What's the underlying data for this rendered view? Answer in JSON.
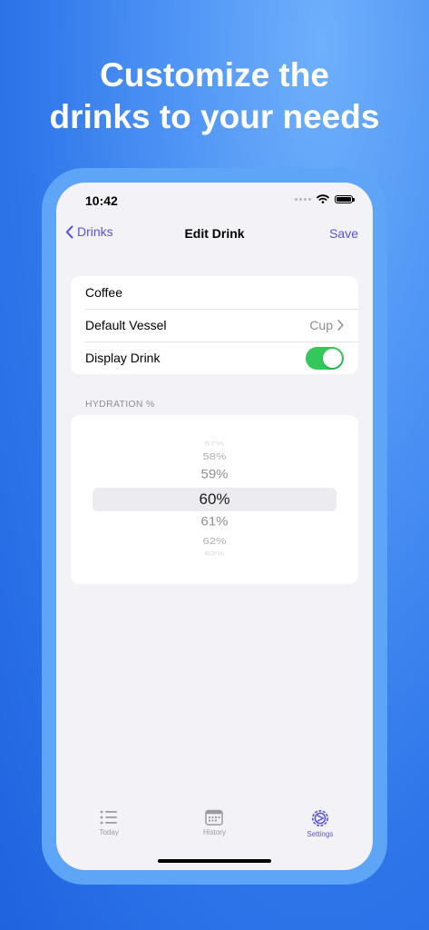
{
  "headline": {
    "line1": "Customize the",
    "line2": "drinks to your needs"
  },
  "status_bar": {
    "time": "10:42"
  },
  "nav": {
    "back_label": "Drinks",
    "title": "Edit Drink",
    "save_label": "Save"
  },
  "form": {
    "name_value": "Coffee",
    "vessel_label": "Default Vessel",
    "vessel_value": "Cup",
    "display_label": "Display Drink",
    "display_on": true
  },
  "hydration": {
    "section_label": "HYDRATION %",
    "options": [
      "57%",
      "58%",
      "59%",
      "60%",
      "61%",
      "62%",
      "63%"
    ],
    "selected": "60%"
  },
  "tabs": [
    {
      "label": "Today",
      "icon": "list-icon"
    },
    {
      "label": "History",
      "icon": "calendar-icon"
    },
    {
      "label": "Settings",
      "icon": "settings-icon"
    }
  ],
  "colors": {
    "accent": "#5a52d8",
    "toggle_on": "#34c759",
    "background": "#2f76ea"
  }
}
